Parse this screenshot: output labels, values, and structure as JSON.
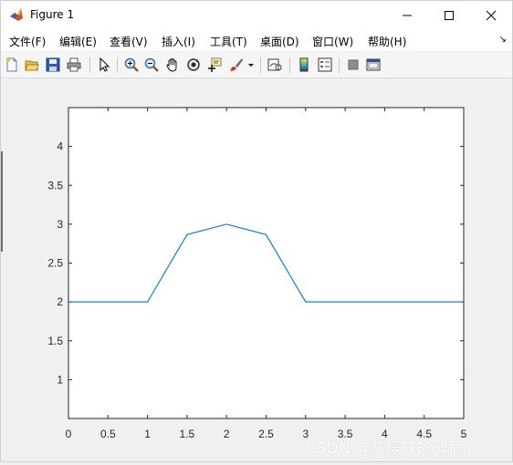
{
  "window": {
    "title": "Figure 1"
  },
  "menu": {
    "items": [
      "文件(F)",
      "编辑(E)",
      "查看(V)",
      "插入(I)",
      "工具(T)",
      "桌面(D)",
      "窗口(W)",
      "帮助(H)"
    ],
    "more": "↘"
  },
  "toolbar": {
    "icons": [
      "new-figure-icon",
      "open-file-icon",
      "save-icon",
      "print-icon",
      "edit-plot-arrow-icon",
      "zoom-in-icon",
      "zoom-out-icon",
      "pan-hand-icon",
      "rotate-3d-icon",
      "data-cursor-icon",
      "brush-icon",
      "link-plot-icon",
      "insert-colorbar-icon",
      "insert-legend-icon",
      "hide-plot-tools-icon",
      "show-plot-tools-icon"
    ]
  },
  "chart_data": {
    "type": "line",
    "x": [
      0,
      0.5,
      1,
      1.5,
      2,
      2.5,
      3,
      3.5,
      4,
      4.5,
      5
    ],
    "y": [
      2,
      2,
      2,
      2.866,
      3,
      2.866,
      2,
      2,
      2,
      2,
      2
    ],
    "xlim": [
      0,
      5
    ],
    "ylim": [
      0.5,
      4.5
    ],
    "xticks": [
      "0",
      "0.5",
      "1",
      "1.5",
      "2",
      "2.5",
      "3",
      "3.5",
      "4",
      "4.5",
      "5"
    ],
    "yticks": [
      "1",
      "1.5",
      "2",
      "2.5",
      "3",
      "3.5",
      "4"
    ],
    "line_color": "#0072bd",
    "grid": false
  },
  "watermark": "CSDN @柠檬味的薄荷心"
}
